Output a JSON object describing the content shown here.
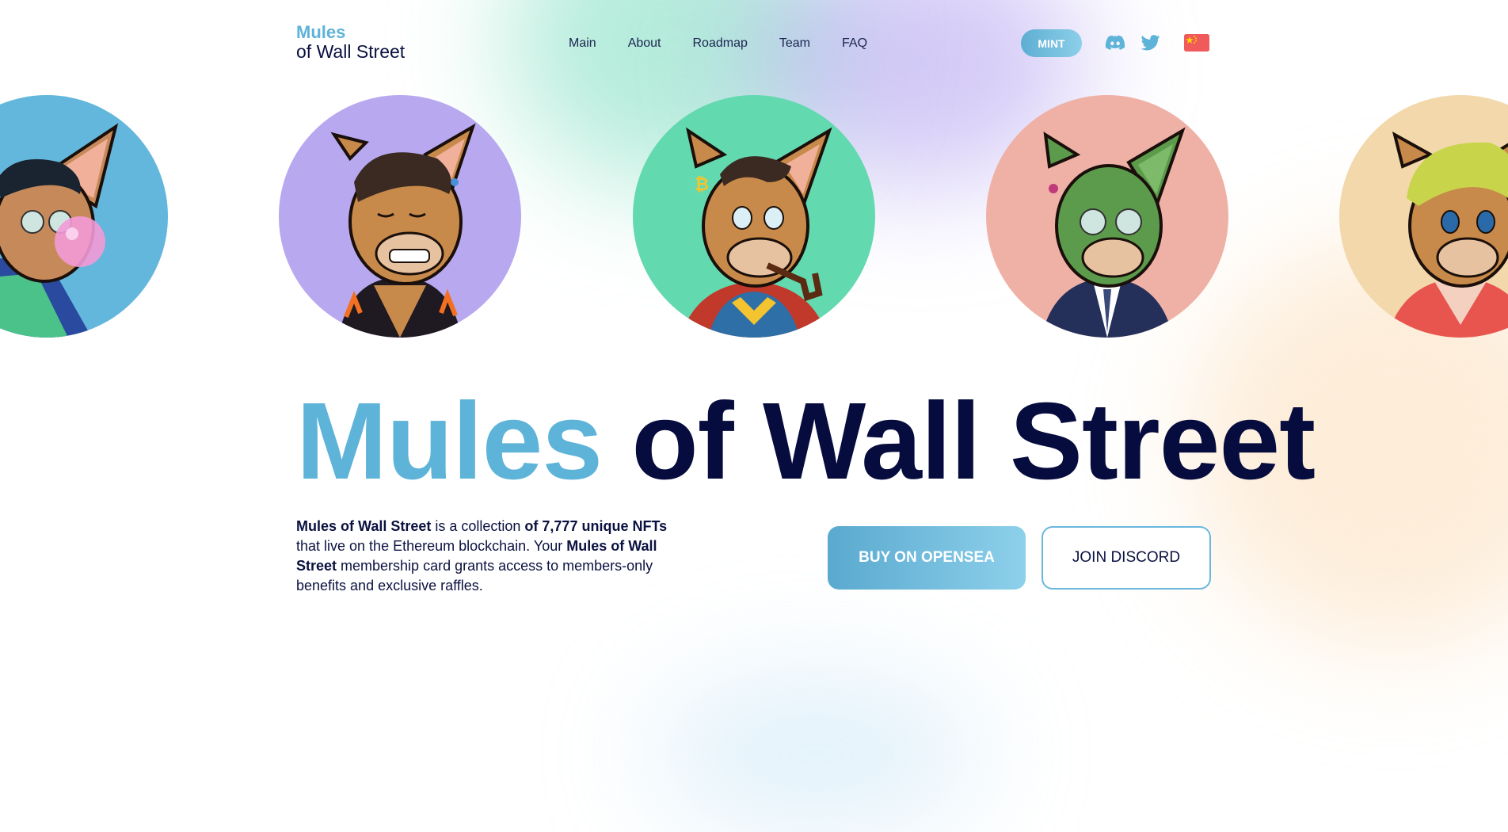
{
  "colors": {
    "accent": "#5eb3d9",
    "dark": "#060c3d"
  },
  "logo": {
    "line1": "Mules",
    "line2": "of Wall Street"
  },
  "nav": {
    "items": [
      {
        "label": "Main"
      },
      {
        "label": "About"
      },
      {
        "label": "Roadmap"
      },
      {
        "label": "Team"
      },
      {
        "label": "FAQ"
      }
    ]
  },
  "header": {
    "mint_label": "MINT",
    "icons": [
      "discord-icon",
      "twitter-icon",
      "china-flag-icon"
    ]
  },
  "avatars": [
    {
      "name": "mule-bubblegum",
      "bg": "#63b6dc"
    },
    {
      "name": "mule-smiling",
      "bg": "#b8a8f0"
    },
    {
      "name": "mule-superhero-pipe",
      "bg": "#63d9b0"
    },
    {
      "name": "mule-green-suit",
      "bg": "#efb1a6"
    },
    {
      "name": "mule-blonde-robe",
      "bg": "#f2d8ab"
    }
  ],
  "hero": {
    "title_part1": "Mules",
    "title_part2": "of Wall Street",
    "desc": {
      "s1": "Mules of Wall Street",
      "s2": " is a collection ",
      "s3": "of 7,777 unique NFTs",
      "s4": " that live on the Ethereum blockchain. Your ",
      "s5": "Mules of Wall Street",
      "s6": " membership card grants access to members-only benefits and exclusive raffles."
    },
    "buy_label": "BUY ON OPENSEA",
    "join_label": "JOIN DISCORD"
  }
}
